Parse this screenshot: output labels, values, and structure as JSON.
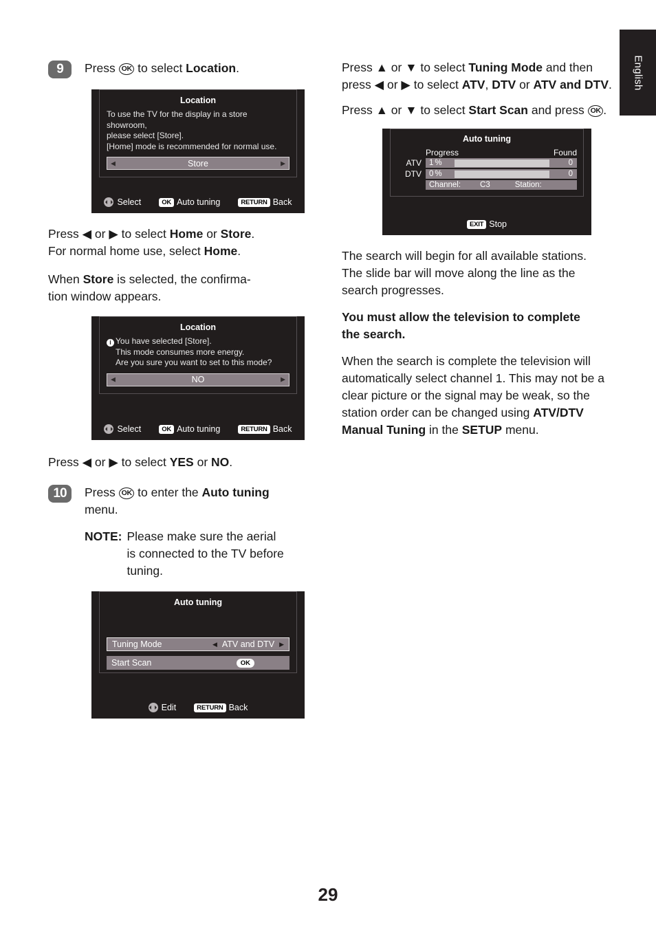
{
  "page": {
    "number": "29",
    "language_tab": "English"
  },
  "left_column": {
    "step9": {
      "badge": "9",
      "text_before": "Press ",
      "ok_icon": "ok-button-icon",
      "ok_label": "OK",
      "text_after": " to select ",
      "target": "Location",
      "period": "."
    },
    "panel_location_select": {
      "title": "Location",
      "line1": "To use the TV for the display in a store showroom,",
      "line2": "please select [Store].",
      "line3": "[Home] mode is recommended for normal use.",
      "selected_value": "Store",
      "arrow_left": "◀",
      "arrow_right": "▶",
      "hints": [
        {
          "icon": "dpad-icon",
          "key": "",
          "label": "Select"
        },
        {
          "icon": "keycap",
          "key": "OK",
          "label": "Auto tuning"
        },
        {
          "icon": "keycap",
          "key": "RETURN",
          "label": "Back"
        }
      ]
    },
    "para_home_store": {
      "l1a": "Press ◀ or ▶ to select ",
      "l1b": "Home",
      "l1c": " or ",
      "l1d": "Store",
      "l1e": ".",
      "l2a": "For normal home use, select ",
      "l2b": "Home",
      "l2c": "."
    },
    "para_confirm": {
      "a": "When ",
      "b": "Store",
      "c": " is selected, the confirma-",
      "d": "tion window appears."
    },
    "panel_location_confirm": {
      "title": "Location",
      "info_glyph": "i",
      "line1": "You have selected [Store].",
      "line2": "This mode consumes more energy.",
      "line3": "Are you sure you want to set to this mode?",
      "selected_value": "NO",
      "arrow_left": "◀",
      "arrow_right": "▶",
      "hints": [
        {
          "icon": "dpad-icon",
          "key": "",
          "label": "Select"
        },
        {
          "icon": "keycap",
          "key": "OK",
          "label": "Auto tuning"
        },
        {
          "icon": "keycap",
          "key": "RETURN",
          "label": "Back"
        }
      ]
    },
    "para_yes_no": {
      "a": "Press ◀ or ▶ to select ",
      "b": "YES",
      "c": " or ",
      "d": "NO",
      "e": "."
    },
    "step10": {
      "badge": "10",
      "text_before": "Press ",
      "ok_label": "OK",
      "text_after": " to enter the ",
      "target": "Auto tuning",
      "line2": "menu."
    },
    "note": {
      "label": "NOTE:",
      "line1": "Please make sure the aerial",
      "line2": "is connected to the TV before",
      "line3": "tuning."
    },
    "panel_auto_menu": {
      "title": "Auto tuning",
      "rows": [
        {
          "label": "Tuning Mode",
          "value": "ATV and DTV",
          "type": "select",
          "selected": true
        },
        {
          "label": "Start Scan",
          "value": "OK",
          "type": "button",
          "selected": false
        }
      ],
      "arrow_left": "◀",
      "arrow_right": "▶",
      "hints": [
        {
          "icon": "dpad-icon",
          "key": "",
          "label": "Edit"
        },
        {
          "icon": "keycap",
          "key": "RETURN",
          "label": "Back"
        }
      ]
    }
  },
  "right_column": {
    "para_tuning_mode": {
      "a": "Press ▲ or ▼ to select ",
      "b": "Tuning Mode",
      "c": " and then press ◀ or ▶ to select ",
      "d": "ATV",
      "e": ", ",
      "f": "DTV",
      "g": " or ",
      "h": "ATV and DTV",
      "i": "."
    },
    "para_start_scan": {
      "a": "Press ▲ or ▼ to select ",
      "b": "Start Scan",
      "c": " and press ",
      "ok_label": "OK",
      "d": "."
    },
    "panel_auto_progress": {
      "title": "Auto tuning",
      "header_progress": "Progress",
      "header_found": "Found",
      "rows": [
        {
          "label": "ATV",
          "percent": "1",
          "percent_sign": "%",
          "progress_value": 1,
          "found": "0"
        },
        {
          "label": "DTV",
          "percent": "0",
          "percent_sign": "%",
          "progress_value": 0,
          "found": "0"
        }
      ],
      "channel_label": "Channel:",
      "channel_value": "C3",
      "station_label": "Station:",
      "station_value": "",
      "hints": [
        {
          "icon": "keycap",
          "key": "EXIT",
          "label": "Stop"
        }
      ]
    },
    "para_search": {
      "l1": "The search will begin for all available stations.",
      "l2": "The slide bar will move along the line as the",
      "l3": "search progresses."
    },
    "para_must_allow": {
      "l1": "You must allow the television to complete",
      "l2": "the search."
    },
    "para_complete": {
      "a": "When the search is complete the television will automatically select channel 1. This may not be a clear picture or the signal may be weak, so the station order can be changed using ",
      "b": "ATV/DTV Manual Tuning",
      "c": " in the ",
      "d": "SETUP",
      "e": " menu."
    }
  }
}
